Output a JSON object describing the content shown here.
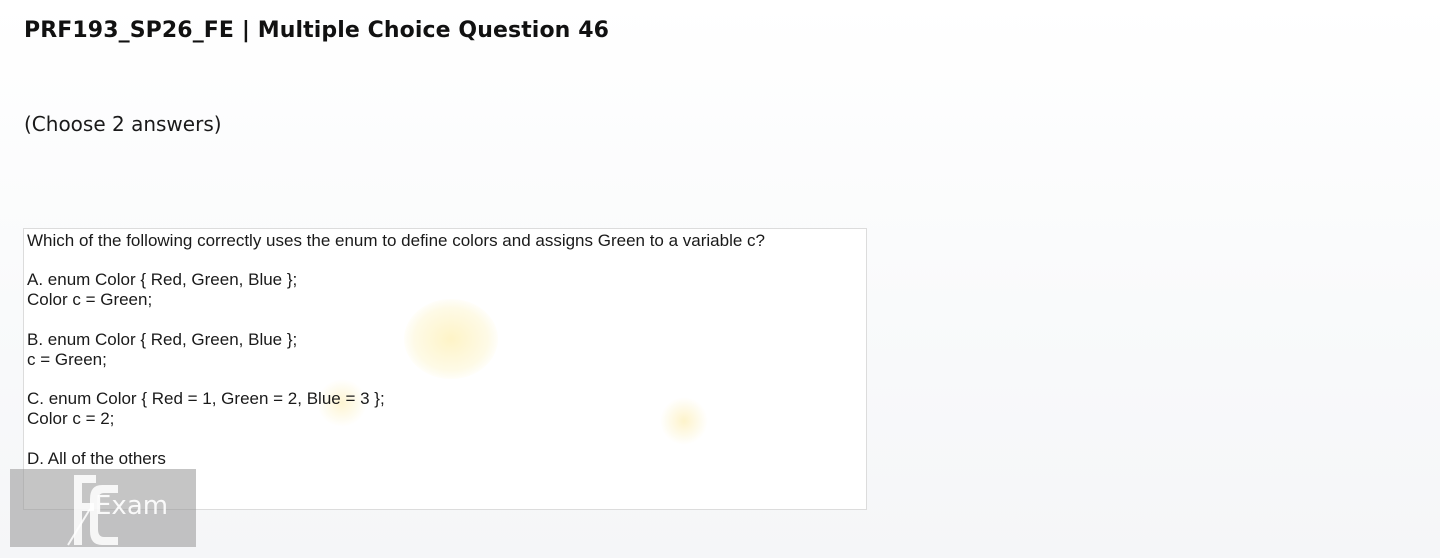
{
  "page": {
    "title": "PRF193_SP26_FE | Multiple Choice Question 46",
    "instruction": "(Choose 2 answers)"
  },
  "question": {
    "stem": "Which of the following correctly uses the enum to define colors and assigns Green to a variable c?",
    "options": [
      {
        "line1": "A.  enum Color { Red, Green, Blue };",
        "line2": "Color c = Green;"
      },
      {
        "line1": "B.  enum Color { Red, Green, Blue };",
        "line2": "c = Green;"
      },
      {
        "line1": "C.  enum Color { Red = 1, Green = 2, Blue = 3 };",
        "line2": "Color c = 2;"
      },
      {
        "line1": "D.  All of the others"
      }
    ]
  },
  "watermark": {
    "text": "Exam",
    "logo": "FC"
  }
}
